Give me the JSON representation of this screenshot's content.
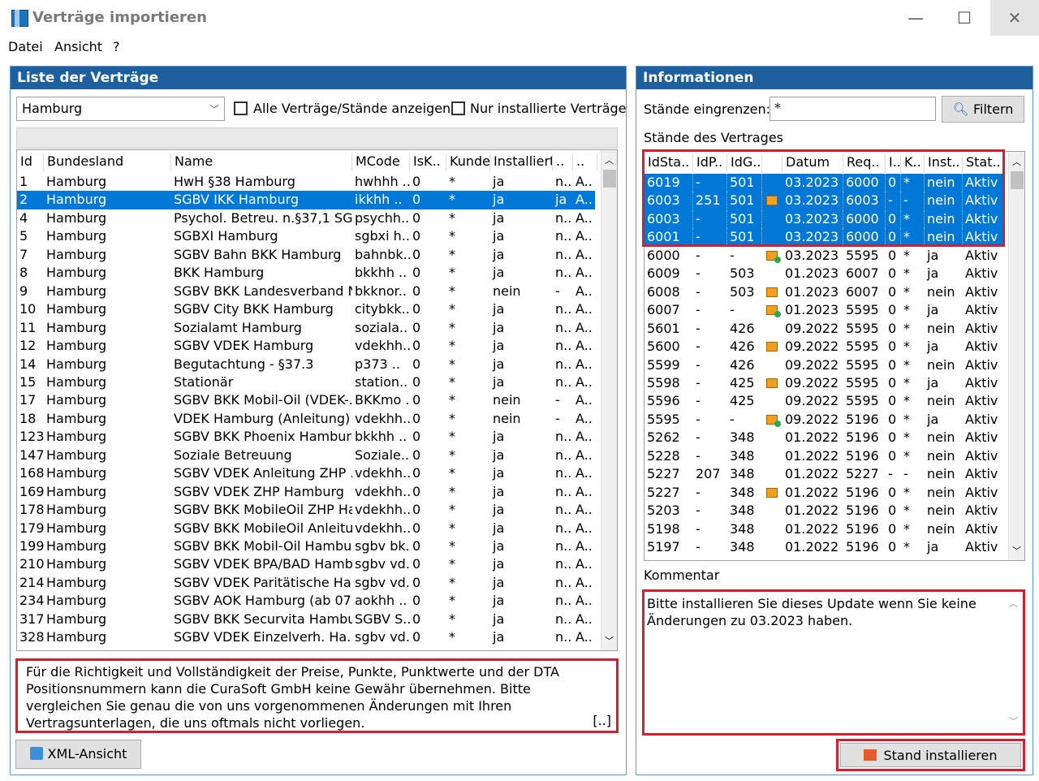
{
  "window": {
    "title": "Verträge importieren",
    "min": "—",
    "max": "☐",
    "close": "✕"
  },
  "menu": [
    "Datei",
    "Ansicht",
    "?"
  ],
  "left": {
    "title": "Liste der Verträge",
    "filter_value": "Hamburg",
    "check_all": "Alle Verträge/Stände anzeigen",
    "check_installed": "Nur installierte Verträge",
    "columns": [
      "Id",
      "Bundesland",
      "Name",
      "MCode",
      "IsK..",
      "Kunde",
      "Installiert",
      "..",
      ".."
    ],
    "rows": [
      [
        "1",
        "Hamburg",
        "HwH §38 Hamburg",
        "hwhhh ..",
        "0",
        "*",
        "ja",
        "n..",
        "A.."
      ],
      [
        "2",
        "Hamburg",
        "SGBV IKK Hamburg",
        "ikkhh    ..",
        "0",
        "*",
        "ja",
        "ja",
        "A.."
      ],
      [
        "4",
        "Hamburg",
        "Psychol. Betreu. n.§37,1 SG..",
        "psychh..",
        "0",
        "*",
        "ja",
        "n..",
        "A.."
      ],
      [
        "5",
        "Hamburg",
        "SGBXI Hamburg",
        "sgbxi h..",
        "0",
        "*",
        "ja",
        "n..",
        "A.."
      ],
      [
        "7",
        "Hamburg",
        "SGBV Bahn BKK Hamburg",
        "bahnbk..",
        "0",
        "*",
        "ja",
        "n..",
        "A.."
      ],
      [
        "8",
        "Hamburg",
        "BKK Hamburg",
        "bkkhh  ..",
        "0",
        "*",
        "ja",
        "n..",
        "A.."
      ],
      [
        "9",
        "Hamburg",
        "SGBV BKK Landesverband N..",
        "bkknor..",
        "0",
        "*",
        "nein",
        "-",
        "A.."
      ],
      [
        "10",
        "Hamburg",
        "SGBV City BKK Hamburg",
        "citybkk..",
        "0",
        "*",
        "ja",
        "n..",
        "A.."
      ],
      [
        "11",
        "Hamburg",
        "Sozialamt Hamburg",
        "soziala..",
        "0",
        "*",
        "ja",
        "n..",
        "A.."
      ],
      [
        "12",
        "Hamburg",
        "SGBV VDEK Hamburg",
        "vdekhh..",
        "0",
        "*",
        "ja",
        "n..",
        "A.."
      ],
      [
        "14",
        "Hamburg",
        "Begutachtung - §37.3",
        "p373   ..",
        "0",
        "*",
        "ja",
        "n..",
        "A.."
      ],
      [
        "15",
        "Hamburg",
        "Stationär",
        "station..",
        "0",
        "*",
        "ja",
        "n..",
        "A.."
      ],
      [
        "17",
        "Hamburg",
        "SGBV BKK Mobil-Oil (VDEK-..",
        "BKKmo ..",
        "0",
        "*",
        "nein",
        "-",
        "A.."
      ],
      [
        "18",
        "Hamburg",
        "VDEK Hamburg (Anleitung)",
        "vdekhh..",
        "0",
        "*",
        "nein",
        "-",
        "A.."
      ],
      [
        "123",
        "Hamburg",
        "SGBV BKK Phoenix Hamburg",
        "bkkhh  ..",
        "0",
        "*",
        "ja",
        "n..",
        "A.."
      ],
      [
        "147",
        "Hamburg",
        "Soziale Betreuung",
        "Soziale..",
        "0",
        "*",
        "ja",
        "n..",
        "A.."
      ],
      [
        "168",
        "Hamburg",
        "SGBV VDEK Anleitung ZHP ..",
        "vdekhh..",
        "0",
        "*",
        "ja",
        "n..",
        "A.."
      ],
      [
        "169",
        "Hamburg",
        "SGBV VDEK ZHP Hamburg",
        "vdekhh..",
        "0",
        "*",
        "ja",
        "n..",
        "A.."
      ],
      [
        "178",
        "Hamburg",
        "SGBV BKK MobileOil ZHP Ha..",
        "vdekhh..",
        "0",
        "*",
        "ja",
        "n..",
        "A.."
      ],
      [
        "179",
        "Hamburg",
        "SGBV BKK MobileOil Anleitu..",
        "vdekhh..",
        "0",
        "*",
        "ja",
        "n..",
        "A.."
      ],
      [
        "199",
        "Hamburg",
        "SGBV BKK Mobil-Oil Hamburg",
        "sgbv bk..",
        "0",
        "*",
        "ja",
        "n..",
        "A.."
      ],
      [
        "210",
        "Hamburg",
        "SGBV VDEK BPA/BAD Hamb..",
        "sgbv vd..",
        "0",
        "*",
        "ja",
        "n..",
        "A.."
      ],
      [
        "214",
        "Hamburg",
        "SGBV VDEK Paritätische Ha..",
        "sgbv vd..",
        "0",
        "*",
        "ja",
        "n..",
        "A.."
      ],
      [
        "234",
        "Hamburg",
        "SGBV AOK Hamburg (ab 07..",
        "aokhh  ..",
        "0",
        "*",
        "ja",
        "n..",
        "A.."
      ],
      [
        "317",
        "Hamburg",
        "SGBV BKK Securvita Hambu..",
        "SGBV S..",
        "0",
        "*",
        "ja",
        "n..",
        "A.."
      ],
      [
        "328",
        "Hamburg",
        "SGBV VDEK Einzelverh. Ha..",
        "sgbv vd..",
        "0",
        "*",
        "ja",
        "n..",
        "A.."
      ]
    ],
    "selected_index": 1,
    "disclaimer": "Für die Richtigkeit und Vollständigkeit der Preise, Punkte, Punktwerte und der DTA Positionsnummern kann die CuraSoft GmbH keine Gewähr übernehmen. Bitte vergleichen Sie genau die von uns vorgenommenen Änderungen mit Ihren Vertragsunterlagen, die uns oftmals nicht vorliegen.",
    "more": "[..]",
    "xml_button": "XML-Ansicht"
  },
  "right": {
    "title": "Informationen",
    "limit_label": "Stände eingrenzen:",
    "limit_value": "*",
    "filter_button": "Filtern",
    "states_label": "Stände des Vertrages",
    "columns": [
      "IdSta..",
      "IdP..",
      "IdG..",
      "",
      "Datum",
      "Req..",
      "I..",
      "K..",
      "Inst..",
      "Stat.."
    ],
    "rows": [
      [
        "6019",
        "-",
        "501",
        "",
        "03.2023",
        "6000",
        "0",
        "*",
        "nein",
        "Aktiv"
      ],
      [
        "6003",
        "251",
        "501",
        "pkg",
        "03.2023",
        "6003",
        "-",
        "-",
        "nein",
        "Aktiv"
      ],
      [
        "6003",
        "-",
        "501",
        "",
        "03.2023",
        "6000",
        "0",
        "*",
        "nein",
        "Aktiv"
      ],
      [
        "6001",
        "-",
        "501",
        "",
        "03.2023",
        "6000",
        "0",
        "*",
        "nein",
        "Aktiv"
      ],
      [
        "6000",
        "-",
        "-",
        "pkg+",
        "03.2023",
        "5595",
        "0",
        "*",
        "ja",
        "Aktiv"
      ],
      [
        "6009",
        "-",
        "503",
        "",
        "01.2023",
        "6007",
        "0",
        "*",
        "ja",
        "Aktiv"
      ],
      [
        "6008",
        "-",
        "503",
        "pkg",
        "01.2023",
        "6007",
        "0",
        "*",
        "nein",
        "Aktiv"
      ],
      [
        "6007",
        "-",
        "-",
        "pkg+",
        "01.2023",
        "5595",
        "0",
        "*",
        "ja",
        "Aktiv"
      ],
      [
        "5601",
        "-",
        "426",
        "",
        "09.2022",
        "5595",
        "0",
        "*",
        "nein",
        "Aktiv"
      ],
      [
        "5600",
        "-",
        "426",
        "pkg",
        "09.2022",
        "5595",
        "0",
        "*",
        "ja",
        "Aktiv"
      ],
      [
        "5599",
        "-",
        "426",
        "",
        "09.2022",
        "5595",
        "0",
        "*",
        "nein",
        "Aktiv"
      ],
      [
        "5598",
        "-",
        "425",
        "pkg",
        "09.2022",
        "5595",
        "0",
        "*",
        "ja",
        "Aktiv"
      ],
      [
        "5596",
        "-",
        "425",
        "",
        "09.2022",
        "5595",
        "0",
        "*",
        "nein",
        "Aktiv"
      ],
      [
        "5595",
        "-",
        "-",
        "pkg+",
        "09.2022",
        "5196",
        "0",
        "*",
        "ja",
        "Aktiv"
      ],
      [
        "5262",
        "-",
        "348",
        "",
        "01.2022",
        "5196",
        "0",
        "*",
        "nein",
        "Aktiv"
      ],
      [
        "5228",
        "-",
        "348",
        "",
        "01.2022",
        "5196",
        "0",
        "*",
        "nein",
        "Aktiv"
      ],
      [
        "5227",
        "207",
        "348",
        "",
        "01.2022",
        "5227",
        "-",
        "-",
        "nein",
        "Aktiv"
      ],
      [
        "5227",
        "-",
        "348",
        "pkg",
        "01.2022",
        "5196",
        "0",
        "*",
        "nein",
        "Aktiv"
      ],
      [
        "5203",
        "-",
        "348",
        "",
        "01.2022",
        "5196",
        "0",
        "*",
        "nein",
        "Aktiv"
      ],
      [
        "5198",
        "-",
        "348",
        "",
        "01.2022",
        "5196",
        "0",
        "*",
        "nein",
        "Aktiv"
      ],
      [
        "5197",
        "-",
        "348",
        "",
        "01.2022",
        "5196",
        "0",
        "*",
        "ja",
        "Aktiv"
      ]
    ],
    "selected_count": 4,
    "comment_label": "Kommentar",
    "comment": "Bitte installieren Sie dieses Update wenn Sie keine Änderungen zu 03.2023 haben.",
    "install_button": "Stand installieren"
  },
  "colors": {
    "accent": "#1e5f9e",
    "selection": "#0078d7",
    "highlight": "#d32030"
  }
}
